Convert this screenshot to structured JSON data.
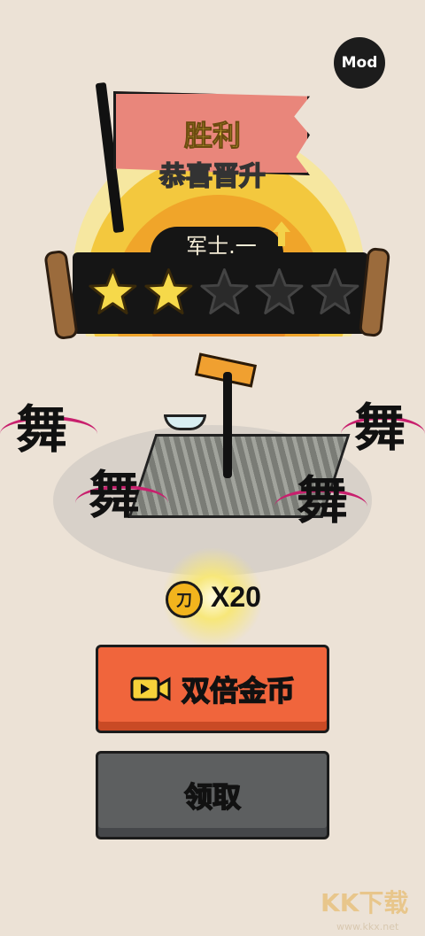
{
  "mod_badge": "Mod",
  "result": {
    "title": "胜利",
    "subtitle": "恭喜晋升",
    "rank": "军士.一",
    "stars_filled": 2,
    "stars_total": 5
  },
  "scene": {
    "dancer_glyph": "舞",
    "dancer_count": 4
  },
  "reward": {
    "coin_glyph": "刀",
    "count_label": "X20"
  },
  "buttons": {
    "double_label": "双倍金币",
    "claim_label": "领取"
  },
  "watermark": {
    "text": "KK下载",
    "url": "www.kkx.net"
  },
  "colors": {
    "background": "#ece2d6",
    "double_button": "#f0653c",
    "claim_button": "#5d5f60",
    "star_filled": "#f6d94a",
    "star_empty": "#2a2a2a",
    "flag": "#e9867b"
  },
  "icons": {
    "video": "video-camera-icon",
    "rank_up": "arrow-up-icon",
    "coin": "coin-icon"
  }
}
